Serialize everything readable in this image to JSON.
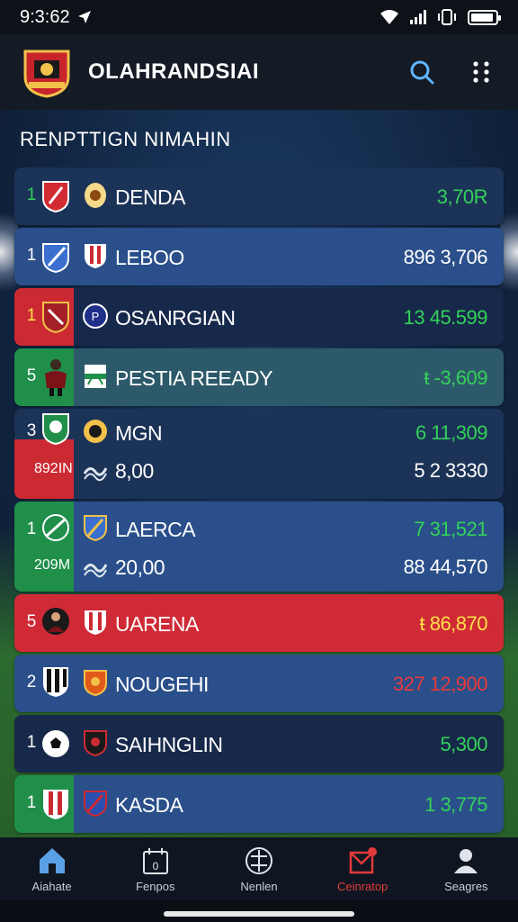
{
  "status": {
    "time": "9:3:62"
  },
  "app": {
    "title": "OLAHRANDSIAI"
  },
  "section": {
    "title": "RENPTTIGN NIMAHIN"
  },
  "rows": [
    {
      "rank": "1",
      "team": "DENDA",
      "score": "3,70R"
    },
    {
      "rank": "1",
      "team": "LEBOO",
      "score": "896 3,706"
    },
    {
      "rank": "1",
      "team": "OSANRGIAN",
      "score": "13 45.599"
    },
    {
      "rank": "5",
      "team": "PESTIA REEADY",
      "score": "ŧ -3,609"
    },
    {
      "rank": "3",
      "team": "MGN",
      "score": "6 11,309",
      "sub_label": "892IN",
      "sub_team": "8,00",
      "sub_score": "5 2 3330"
    },
    {
      "rank": "1",
      "team": "LAERCA",
      "score": "7 31,521",
      "sub_label": "209M",
      "sub_team": "20,00",
      "sub_score": "88 44,570"
    },
    {
      "rank": "5",
      "team": "UARENA",
      "score": "ŧ 86,870"
    },
    {
      "rank": "2",
      "team": "NOUGEHI",
      "score": "327 12,900"
    },
    {
      "rank": "1",
      "team": "SAIHNGLIN",
      "score": "5,300"
    },
    {
      "rank": "1",
      "team": "KASDA",
      "score": "1 3,775"
    }
  ],
  "nav": [
    {
      "label": "Aiahate"
    },
    {
      "label": "Fenpos"
    },
    {
      "label": "Nenlen"
    },
    {
      "label": "Ceinratop"
    },
    {
      "label": "Seagres"
    }
  ],
  "colors": {
    "accent_green": "#33d15a",
    "accent_red": "#e23a3a",
    "accent_yellow": "#ffe048"
  }
}
